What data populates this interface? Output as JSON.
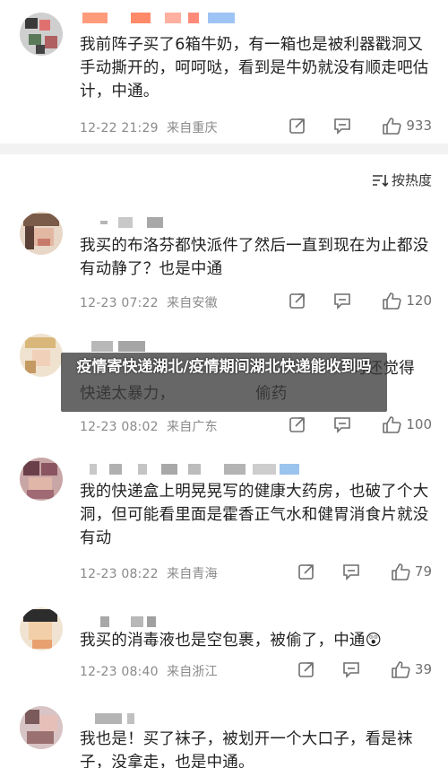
{
  "comments": [
    {
      "text": "我前阵子买了6箱牛奶，有一箱也是被利器戳洞又手动撕开的，呵呵哒，看到是牛奶就没有顺走吧估计，中通。",
      "time": "12-22 21:29",
      "source": "来自重庆",
      "likes": "933"
    },
    {
      "text": "我买的布洛芬都快派件了然后一直到现在为止都没有动静了？也是中通",
      "time": "12-23 07:22",
      "source": "来自安徽",
      "likes": "120"
    },
    {
      "text": "时还觉得快递太暴力，偷药",
      "time": "12-23 08:02",
      "source": "来自广东",
      "likes": "100"
    },
    {
      "text": "我的快递盒上明晃晃写的健康大药房，也破了个大洞，但可能看里面是霍香正气水和健胃消食片就没有动",
      "time": "12-23 08:22",
      "source": "来自青海",
      "likes": "79"
    },
    {
      "text": "我买的消毒液也是空包裹，被偷了，中通😲",
      "time": "12-23 08:40",
      "source": "来自浙江",
      "likes": "39"
    },
    {
      "text": "我也是！买了袜子，被划开一个大口子，看是袜子，没拿走，也是中通。",
      "time": "",
      "source": "",
      "likes": ""
    }
  ],
  "sort": {
    "label": "按热度"
  },
  "overlay": {
    "title": "疫情寄快递湖北/疫情期间湖北快递能收到吗"
  }
}
